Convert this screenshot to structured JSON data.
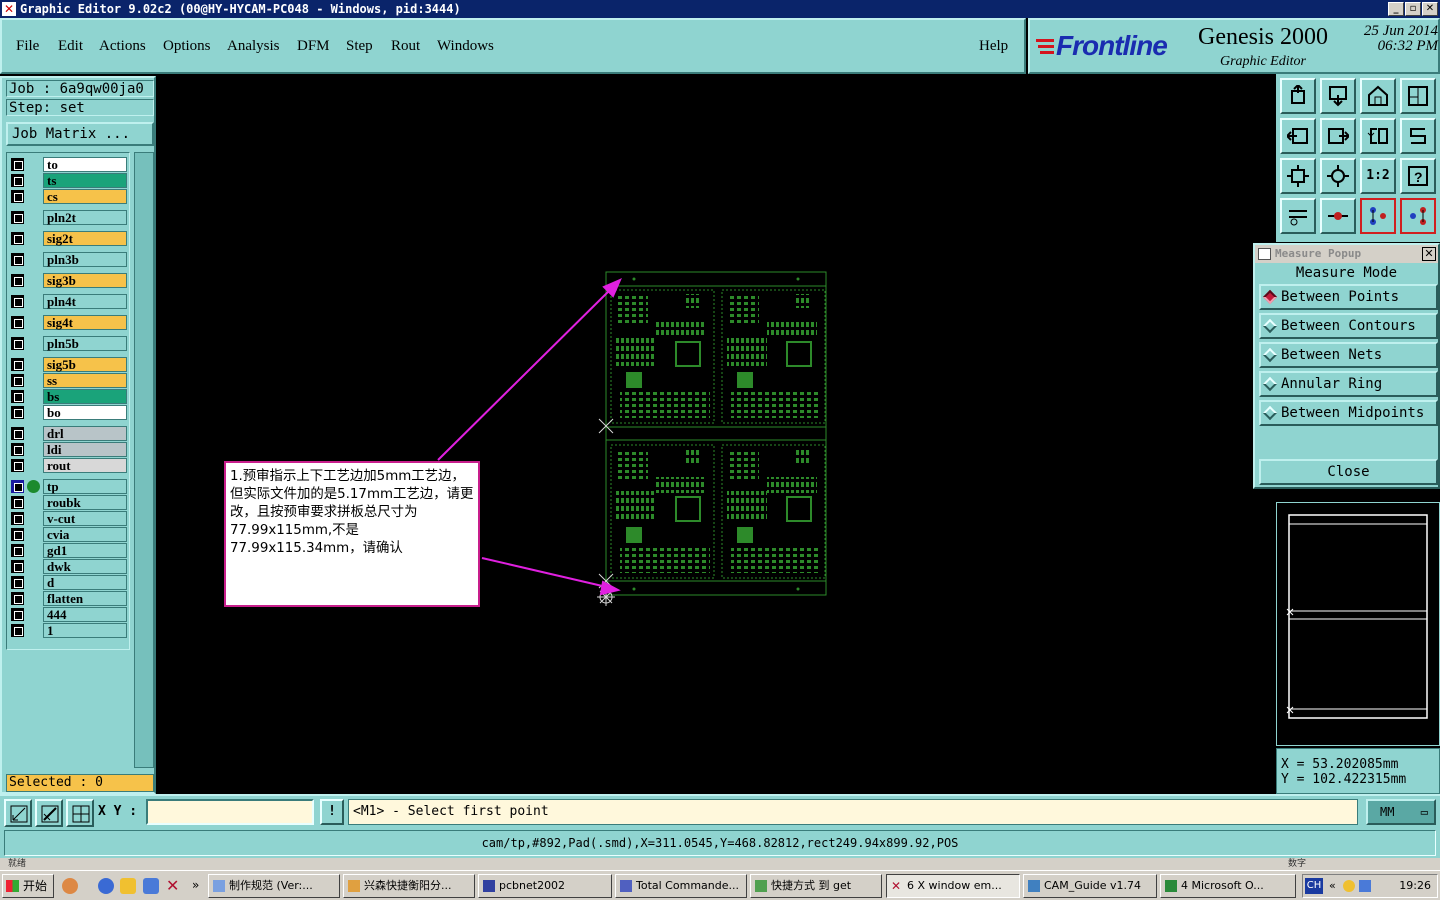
{
  "window": {
    "title": "Graphic Editor 9.02c2 (00@HY-HYCAM-PC048 - Windows, pid:3444)",
    "icon": "x-logo-icon",
    "minimize": "_",
    "maximize": "▫",
    "close": "✕"
  },
  "menu": {
    "items": [
      "File",
      "Edit",
      "Actions",
      "Options",
      "Analysis",
      "DFM",
      "Step",
      "Rout",
      "Windows"
    ],
    "help": "Help"
  },
  "brand": {
    "logo": "Frontline",
    "product": "Genesis 2000",
    "subtitle": "Graphic Editor",
    "date": "25 Jun 2014",
    "time": "06:32 PM"
  },
  "job": {
    "job_label": "Job : 6a9qw00ja0",
    "step_label": "Step: set",
    "matrix_button": "Job Matrix ..."
  },
  "layers": [
    {
      "name": "to",
      "color": "#ffffff"
    },
    {
      "name": "ts",
      "color": "#1aa37a"
    },
    {
      "name": "cs",
      "color": "#f6c24a"
    },
    {
      "name": "pln2t",
      "color": "#8fd4d0"
    },
    {
      "name": "sig2t",
      "color": "#f6c24a"
    },
    {
      "name": "pln3b",
      "color": "#8fd4d0"
    },
    {
      "name": "sig3b",
      "color": "#f6c24a"
    },
    {
      "name": "pln4t",
      "color": "#8fd4d0"
    },
    {
      "name": "sig4t",
      "color": "#f6c24a"
    },
    {
      "name": "pln5b",
      "color": "#8fd4d0"
    },
    {
      "name": "sig5b",
      "color": "#f6c24a"
    },
    {
      "name": "ss",
      "color": "#f6c24a"
    },
    {
      "name": "bs",
      "color": "#1aa37a"
    },
    {
      "name": "bo",
      "color": "#ffffff"
    },
    {
      "name": "drl",
      "color": "#b8c4c8"
    },
    {
      "name": "ldi",
      "color": "#b8c4c8"
    },
    {
      "name": "rout",
      "color": "#d8d8d8"
    },
    {
      "name": "tp",
      "color": "#8fd4d0",
      "active": true
    },
    {
      "name": "roubk",
      "color": "#8fd4d0"
    },
    {
      "name": "v-cut",
      "color": "#8fd4d0"
    },
    {
      "name": "cvia",
      "color": "#8fd4d0"
    },
    {
      "name": "gd1",
      "color": "#8fd4d0"
    },
    {
      "name": "dwk",
      "color": "#8fd4d0"
    },
    {
      "name": "d",
      "color": "#8fd4d0"
    },
    {
      "name": "flatten",
      "color": "#8fd4d0"
    },
    {
      "name": "444",
      "color": "#8fd4d0"
    },
    {
      "name": "1",
      "color": "#8fd4d0"
    }
  ],
  "selected": "Selected : 0",
  "measure": {
    "title": "Measure Popup",
    "heading": "Measure Mode",
    "options": [
      "Between Points",
      "Between Contours",
      "Between Nets",
      "Annular Ring",
      "Between Midpoints"
    ],
    "selected_index": 0,
    "close": "Close"
  },
  "coords": {
    "x": "X = 53.202085mm",
    "y": "Y = 102.422315mm"
  },
  "annotation": {
    "text": "1.预审指示上下工艺边加5mm工艺边，但实际文件加的是5.17mm工艺边，请更改，且按预审要求拼板总尺寸为77.99x115mm,不是77.99x115.34mm，请确认"
  },
  "bottom": {
    "xy_label": "X Y :",
    "xy_value": "",
    "excl": "!",
    "prompt": "<M1> - Select first point",
    "units": "MM"
  },
  "status_text": "cam/tp,#892,Pad(.smd),X=311.0545,Y=468.82812,rect249.94x899.92,POS",
  "hint": {
    "left": "就绪",
    "right": "数字"
  },
  "taskbar": {
    "start": "开始",
    "tasks": [
      "制作规范 (Ver:...",
      "兴森快捷衡阳分...",
      "pcbnet2002",
      "Total Commande...",
      "快捷方式 到 get",
      "6 X window em...",
      "CAM_Guide v1.74",
      "4 Microsoft O..."
    ],
    "active_index": 5,
    "ch": "CH",
    "clock": "19:26"
  },
  "colors": {
    "panel": "#8fd4d0",
    "pcb_green": "#2d8a2a",
    "arrow_magenta": "#e020e0"
  }
}
